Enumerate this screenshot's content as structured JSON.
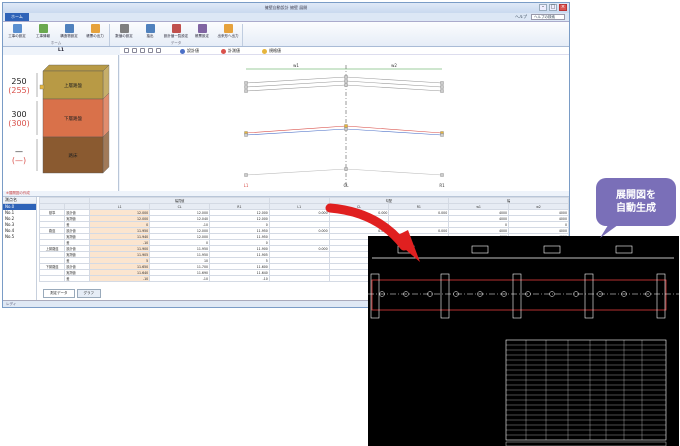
{
  "window": {
    "title": "擁壁自動設計  擁壁 展開",
    "controls": [
      "–",
      "□",
      "×"
    ]
  },
  "tabs": {
    "home": "ホーム",
    "help": "ヘルプ",
    "search_placeholder": "ヘルプの検索"
  },
  "ribbon": {
    "groups": [
      {
        "name": "ホーム",
        "buttons": [
          {
            "label": "工事の設定",
            "icon": "project-icon",
            "color": "#5a8fd0"
          },
          {
            "label": "工事情報",
            "icon": "info-icon",
            "color": "#6aa84f"
          },
          {
            "label": "構造物設定",
            "icon": "structure-icon",
            "color": "#4f81bd"
          },
          {
            "label": "帳票の出力",
            "icon": "report-icon",
            "color": "#e6a23c"
          }
        ]
      },
      {
        "name": "データ",
        "buttons": [
          {
            "label": "数値の設定",
            "icon": "number-icon",
            "color": "#7f7f7f"
          },
          {
            "label": "抽出",
            "icon": "extract-icon",
            "color": "#4f81bd"
          },
          {
            "label": "設計値一覧設定",
            "icon": "list-icon",
            "color": "#c0504d"
          },
          {
            "label": "帳票設定",
            "icon": "sheet-icon",
            "color": "#8064a2"
          },
          {
            "label": "出来形へ出力",
            "icon": "export-icon",
            "color": "#e6a23c"
          }
        ]
      }
    ]
  },
  "layer_panel": {
    "title": "L1",
    "layers": [
      {
        "name": "上層路盤",
        "value": "250",
        "sub": "(255)",
        "color": "#b89a45"
      },
      {
        "name": "下層路盤",
        "value": "300",
        "sub": "(300)",
        "color": "#d9714a"
      },
      {
        "name": "路床",
        "value": "—",
        "sub": "(—)",
        "color": "#8a5a30"
      }
    ]
  },
  "plot": {
    "legend": [
      {
        "label": "設計値",
        "color": "#4b6fc7"
      },
      {
        "label": "計測値",
        "color": "#d9514b"
      },
      {
        "label": "規格値",
        "color": "#e6b53c"
      }
    ],
    "bottom_labels": [
      "L1",
      "CL",
      "R1"
    ],
    "span_labels": [
      "w1",
      "w2"
    ],
    "toolbar": [
      "⊕",
      "⊖",
      "⊙",
      "◻",
      "⇕"
    ]
  },
  "section_label": "※展開図の作成",
  "list": {
    "header": "測点名",
    "items": [
      "No.0",
      "No.1",
      "No.2",
      "No.3",
      "No.4",
      "No.5"
    ],
    "selected": 0
  },
  "grid": {
    "col_groups": [
      "",
      "",
      "幅員値",
      "",
      "",
      "",
      "勾配",
      "",
      "",
      "幅",
      ""
    ],
    "col_heads": [
      "",
      "",
      "L1",
      "CL",
      "R1",
      "L1",
      "CL",
      "R1",
      "w1",
      "w2"
    ],
    "rows": [
      {
        "g": "基準",
        "s": "設計値",
        "v": [
          "12.000",
          "12.000",
          "12.000",
          "0.000",
          "0.000",
          "0.000",
          "4000",
          "4000"
        ]
      },
      {
        "g": "",
        "s": "実測値",
        "v": [
          "12.000",
          "12.040",
          "12.000",
          "",
          "",
          "",
          "4000",
          "4000"
        ]
      },
      {
        "g": "",
        "s": "差",
        "v": [
          "0",
          "-10",
          "0",
          "",
          "",
          "",
          "0",
          "0"
        ]
      },
      {
        "g": "路盤",
        "s": "設計値",
        "v": [
          "11.950",
          "12.000",
          "11.950",
          "0.000",
          "0.000",
          "0.000",
          "4000",
          "4000"
        ]
      },
      {
        "g": "",
        "s": "実測値",
        "v": [
          "11.940",
          "12.000",
          "11.950",
          "",
          "",
          "",
          "4000",
          "4000"
        ]
      },
      {
        "g": "",
        "s": "差",
        "v": [
          "-10",
          "0",
          "0",
          "",
          "",
          "",
          "",
          ""
        ]
      },
      {
        "g": "上層路盤",
        "s": "設計値",
        "v": [
          "11.900",
          "11.950",
          "11.900",
          "0.000",
          "",
          "",
          "",
          ""
        ]
      },
      {
        "g": "",
        "s": "実測値",
        "v": [
          "11.905",
          "11.950",
          "11.905",
          "",
          "",
          "",
          "",
          ""
        ]
      },
      {
        "g": "",
        "s": "差",
        "v": [
          "5",
          "10",
          "5",
          "",
          "",
          "",
          "",
          ""
        ]
      },
      {
        "g": "下層路盤",
        "s": "設計値",
        "v": [
          "11.650",
          "11.700",
          "11.600",
          "",
          "",
          "",
          "",
          ""
        ]
      },
      {
        "g": "",
        "s": "実測値",
        "v": [
          "11.640",
          "11.690",
          "11.640",
          "",
          "",
          "",
          "",
          ""
        ]
      },
      {
        "g": "",
        "s": "差",
        "v": [
          "-10",
          "-10",
          "-10",
          "",
          "",
          "",
          "",
          ""
        ]
      }
    ]
  },
  "bottom_tabs": [
    "測定データ",
    "グラフ"
  ],
  "status": "レディ",
  "callout": {
    "line1": "展開図を",
    "line2": "自動生成"
  },
  "accent": "#2e63b8",
  "arrow_color": "#e02020"
}
